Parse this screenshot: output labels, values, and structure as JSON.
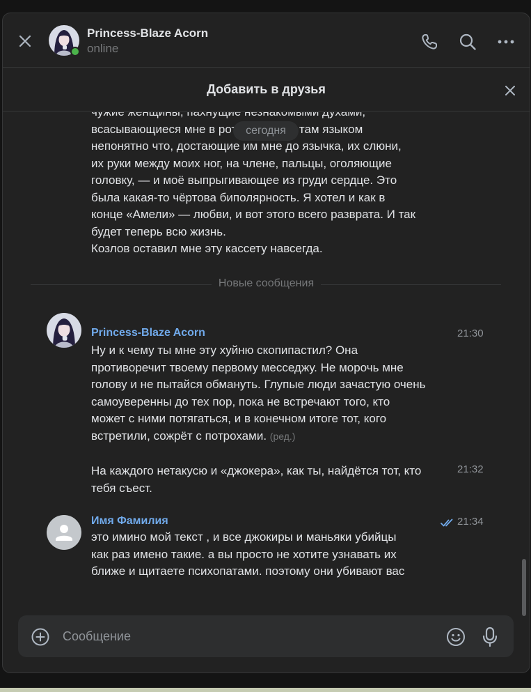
{
  "header": {
    "contact_name": "Princess-Blaze Acorn",
    "status": "online",
    "close_icon": "close-icon",
    "icons": [
      "phone-icon",
      "search-icon",
      "more-icon"
    ]
  },
  "add_friend": {
    "label": "Добавить в друзья",
    "close_icon": "close-icon"
  },
  "history": {
    "date_pill": "сегодня",
    "earlier_message_lines": [
      "чужие женщины, пахнущие незнакомыми духами,",
      "всасывающиеся мне в рот, вертящие там языком",
      "непонятно что, достающие им мне до язычка, их слюни,",
      "их руки между моих ног, на члене, пальцы, оголяющие",
      "головку, — и моё выпрыгивающее из груди сердце. Это",
      "была какая-то чёртова биполярность. Я хотел и как в",
      "конце «Амели» — любви, и вот этого всего разврата. И так",
      "будет теперь всю жизнь.",
      "Козлов оставил мне эту кассету навсегда."
    ],
    "new_messages_label": "Новые сообщения"
  },
  "messages": [
    {
      "sender": "Princess-Blaze Acorn",
      "time": "21:30",
      "lines": [
        "Ну и к чему ты мне эту хуйню скопипастил? Она",
        "противоречит твоему первому месседжу. Не морочь мне",
        "голову и не пытайся обмануть. Глупые люди зачастую очень",
        "самоуверенны до тех пор, пока не встречают того, кто",
        "может с ними потягаться, и в конечном итоге тот, кого",
        "встретили, сожрёт с потрохами."
      ],
      "edited_label": "(ред.)"
    },
    {
      "time": "21:32",
      "lines": [
        "На каждого нетакусю и «джокера», как ты, найдётся тот, кто",
        "тебя съест."
      ]
    },
    {
      "sender": "Имя Фамилия",
      "time": "21:34",
      "read_icon": "double-check-icon",
      "lines": [
        "это имино мой текст , и все джокиры и маньяки убийцы",
        "как раз имено такие. а вы просто не хотите узнавать их",
        "ближе и щитаете психопатами. поэтому они убивают вас"
      ]
    }
  ],
  "composer": {
    "placeholder": "Сообщение",
    "value": "",
    "icons": [
      "plus-icon",
      "emoji-icon",
      "microphone-icon"
    ]
  },
  "colors": {
    "background": "#222222",
    "accent_link": "#71aaeb",
    "online": "#4bb34b",
    "text": "#e1e3e6",
    "muted": "#909499"
  }
}
